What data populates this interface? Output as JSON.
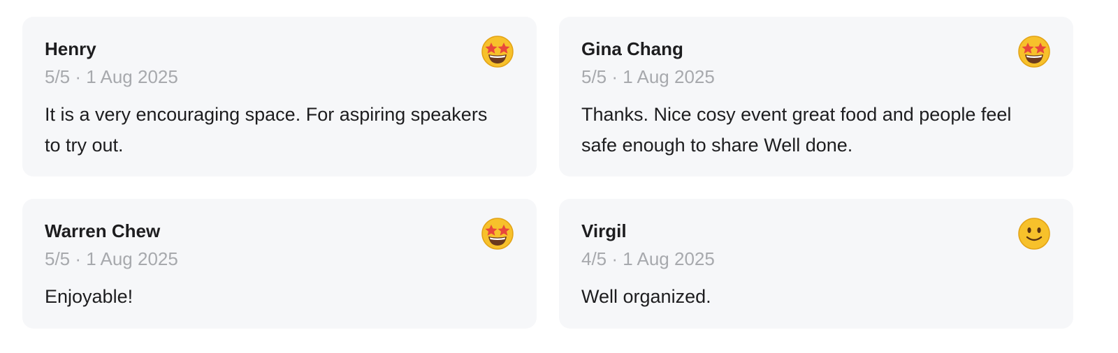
{
  "reviews": [
    {
      "name": "Henry",
      "rating": "5/5",
      "date": "1 Aug 2025",
      "meta": "5/5 · 1 Aug 2025",
      "comment": "It is a very encouraging space. For aspiring speakers to try out.",
      "icon": "star-struck-emoji-icon"
    },
    {
      "name": "Gina Chang",
      "rating": "5/5",
      "date": "1 Aug 2025",
      "meta": "5/5 · 1 Aug 2025",
      "comment": "Thanks. Nice cosy event great food and people feel safe enough to share Well done.",
      "icon": "star-struck-emoji-icon"
    },
    {
      "name": "Warren Chew",
      "rating": "5/5",
      "date": "1 Aug 2025",
      "meta": "5/5 · 1 Aug 2025",
      "comment": "Enjoyable!",
      "icon": "star-struck-emoji-icon"
    },
    {
      "name": "Virgil",
      "rating": "4/5",
      "date": "1 Aug 2025",
      "meta": "4/5 · 1 Aug 2025",
      "comment": "Well organized.",
      "icon": "slightly-smiling-emoji-icon"
    }
  ],
  "colors": {
    "card_background": "#f6f7f9",
    "name_text": "#1d1d1f",
    "meta_text": "#a7a9ad",
    "emoji_face": "#f7c12b"
  }
}
